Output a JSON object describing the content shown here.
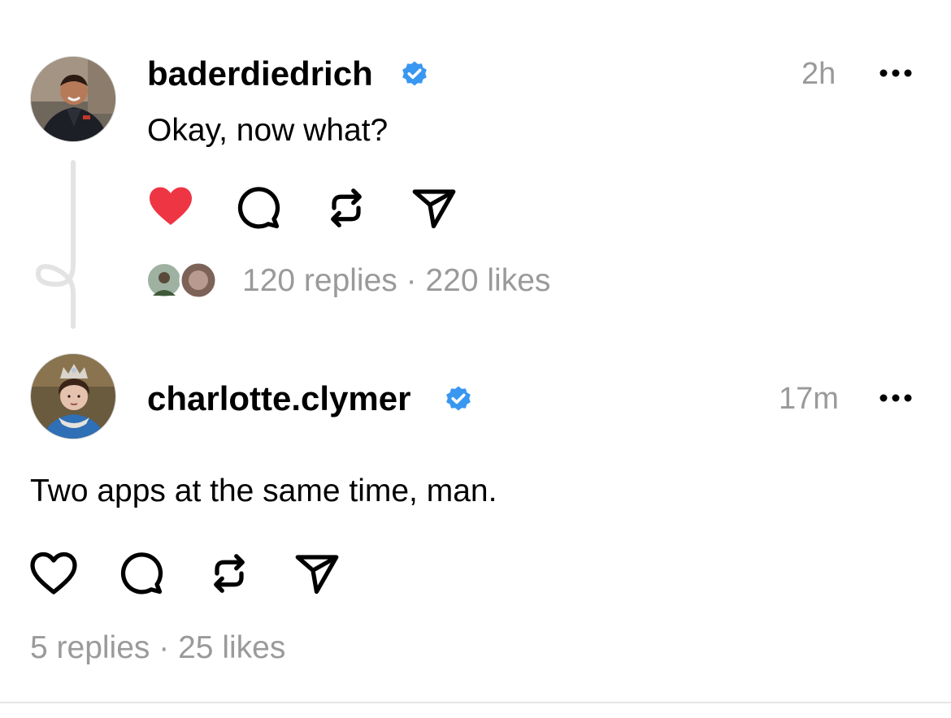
{
  "posts": [
    {
      "username": "baderdiedrich",
      "verified": true,
      "time": "2h",
      "text": "Okay, now what?",
      "liked": true,
      "replies": "120 replies",
      "separator": "·",
      "likes": "220 likes"
    },
    {
      "username": "charlotte.clymer",
      "verified": true,
      "time": "17m",
      "text": "Two apps at the same time, man.",
      "liked": false,
      "replies": "5 replies",
      "separator": "·",
      "likes": "25 likes"
    }
  ],
  "colors": {
    "like_active": "#ee3544",
    "verified_badge": "#3897f0",
    "secondary_text": "#9a9a9a",
    "thread_line": "#e3e3e3"
  },
  "icons": [
    "heart-icon",
    "comment-icon",
    "repost-icon",
    "share-icon",
    "more-icon",
    "verified-badge-icon"
  ]
}
